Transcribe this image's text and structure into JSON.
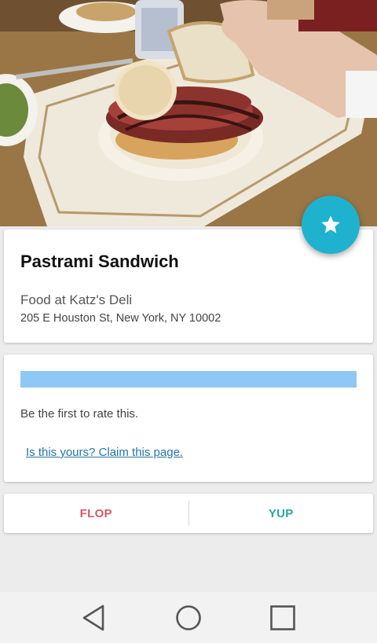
{
  "hero": {
    "image_alt": "Pastrami sandwich on a plate"
  },
  "fab": {
    "icon": "star-icon",
    "color": "#1fb2cf"
  },
  "place": {
    "title": "Pastrami Sandwich",
    "subtitle": "Food at Katz's Deli",
    "address": "205 E Houston St, New York, NY 10002"
  },
  "rating": {
    "bar_color": "#8fc8f5",
    "message": "Be the first to rate this.",
    "claim_link": "Is this yours? Claim this page."
  },
  "actions": {
    "flop_label": "FLOP",
    "yup_label": "YUP",
    "flop_color": "#d35b66",
    "yup_color": "#27a79a"
  },
  "navbar": {
    "back_icon": "back-triangle-icon",
    "home_icon": "home-circle-icon",
    "recents_icon": "recents-square-icon"
  }
}
